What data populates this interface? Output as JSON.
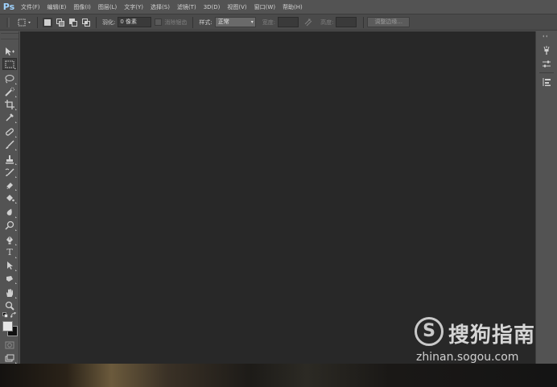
{
  "app": {
    "logo": "Ps",
    "menus": [
      "文件(F)",
      "编辑(E)",
      "图像(I)",
      "图层(L)",
      "文字(Y)",
      "选择(S)",
      "滤镜(T)",
      "3D(D)",
      "视图(V)",
      "窗口(W)",
      "帮助(H)"
    ]
  },
  "options": {
    "feather_label": "羽化:",
    "feather_value": "0 像素",
    "antialias_label": "消除锯齿",
    "style_label": "样式:",
    "style_value": "正常",
    "width_label": "宽度:",
    "height_label": "高度:",
    "refine_edge_button": "调整边缘..."
  },
  "tools": [
    "move-tool",
    "rectangular-marquee-tool",
    "lasso-tool",
    "quick-selection-tool",
    "crop-tool",
    "eyedropper-tool",
    "spot-healing-brush-tool",
    "brush-tool",
    "clone-stamp-tool",
    "history-brush-tool",
    "eraser-tool",
    "paint-bucket-tool",
    "blur-tool",
    "dodge-tool",
    "pen-tool",
    "type-tool",
    "path-selection-tool",
    "rectangle-tool",
    "hand-tool",
    "zoom-tool"
  ],
  "type_tool_glyph": "T",
  "colors": {
    "foreground": "#e6e6e6",
    "background": "#111111",
    "workspace": "#282828",
    "chrome": "#535353"
  },
  "watermark": {
    "logo_glyph": "S",
    "title": "搜狗指南",
    "url": "zhinan.sogou.com"
  }
}
